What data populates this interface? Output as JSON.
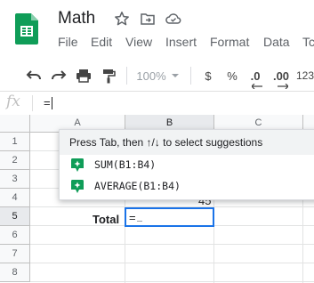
{
  "app": {
    "title": "Math",
    "menu": [
      "File",
      "Edit",
      "View",
      "Insert",
      "Format",
      "Data",
      "Tc"
    ]
  },
  "toolbar": {
    "zoom": "100%",
    "currency": "$",
    "percent": "%",
    "decrease_decimal": ".0",
    "increase_decimal": ".00",
    "more_formats": "123"
  },
  "formula_bar": {
    "fx": "fx",
    "value": "="
  },
  "grid": {
    "columns": [
      "A",
      "B",
      "C"
    ],
    "rows": [
      "1",
      "2",
      "3",
      "4",
      "5",
      "6",
      "7",
      "8"
    ],
    "cells": {
      "b4": "45",
      "a5": "Total",
      "b5": "="
    }
  },
  "autocomplete": {
    "header": "Press Tab, then ↑/↓ to select suggestions",
    "items": [
      "SUM(B1:B4)",
      "AVERAGE(B1:B4)"
    ]
  },
  "colors": {
    "accent": "#1a73e8",
    "sheets_green": "#0f9d58",
    "suggest_green": "#0f9d58"
  }
}
